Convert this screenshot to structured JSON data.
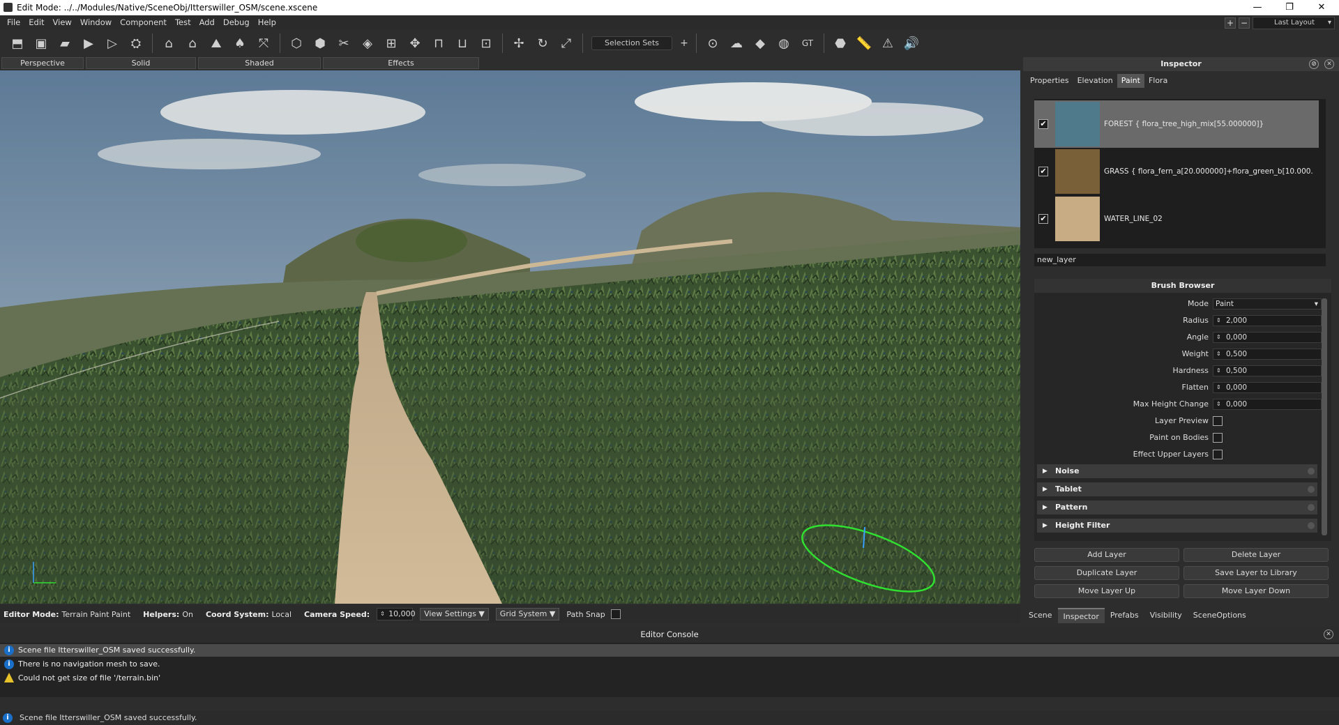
{
  "window": {
    "title": "Edit Mode: ../../Modules/Native/SceneObj/Itterswiller_OSM/scene.xscene",
    "minimize": "—",
    "restore": "❐",
    "close": "✕"
  },
  "menu": [
    "File",
    "Edit",
    "View",
    "Window",
    "Component",
    "Test",
    "Add",
    "Debug",
    "Help"
  ],
  "layout": {
    "add": "+",
    "remove": "−",
    "selected": "Last Layout"
  },
  "toolbar": {
    "selection_sets": "Selection Sets",
    "add": "+",
    "gt_label": "GT"
  },
  "view_tabs": [
    "Perspective",
    "Solid",
    "Shaded",
    "Effects"
  ],
  "statusbar": {
    "editor_mode_label": "Editor Mode:",
    "editor_mode": "Terrain Paint Paint",
    "helpers_label": "Helpers:",
    "helpers": "On",
    "coord_label": "Coord System:",
    "coord": "Local",
    "camera_speed_label": "Camera Speed:",
    "camera_speed": "10,000",
    "view_settings": "View Settings",
    "grid_system": "Grid System",
    "path_snap": "Path Snap"
  },
  "inspector": {
    "title": "Inspector",
    "tabs": [
      "Properties",
      "Elevation",
      "Paint",
      "Flora"
    ],
    "active_tab": "Paint",
    "layers": [
      {
        "name": "FOREST {  flora_tree_high_mix[55.000000]}",
        "checked": true,
        "color": "#4f7a8c"
      },
      {
        "name": "GRASS {  flora_fern_a[20.000000]+flora_green_b[10.000...",
        "checked": true,
        "color": "#7a6038"
      },
      {
        "name": "WATER_LINE_02",
        "checked": true,
        "color": "#c8ad84"
      }
    ],
    "new_layer": "new_layer",
    "brush": {
      "title": "Brush Browser",
      "mode_label": "Mode",
      "mode": "Paint",
      "radius_label": "Radius",
      "radius": "2,000",
      "angle_label": "Angle",
      "angle": "0,000",
      "weight_label": "Weight",
      "weight": "0,500",
      "hardness_label": "Hardness",
      "hardness": "0,500",
      "flatten_label": "Flatten",
      "flatten": "0,000",
      "maxh_label": "Max Height Change",
      "maxh": "0,000",
      "layer_preview": "Layer Preview",
      "paint_bodies": "Paint on Bodies",
      "effect_upper": "Effect Upper Layers",
      "sections": [
        "Noise",
        "Tablet",
        "Pattern",
        "Height Filter"
      ]
    },
    "buttons": {
      "add": "Add Layer",
      "delete": "Delete Layer",
      "duplicate": "Duplicate Layer",
      "save": "Save Layer to Library",
      "up": "Move Layer Up",
      "down": "Move Layer Down"
    }
  },
  "bottom_tabs": [
    "Scene",
    "Inspector",
    "Prefabs",
    "Visibility",
    "SceneOptions"
  ],
  "console": {
    "title": "Editor Console",
    "lines": [
      {
        "type": "info",
        "text": "Scene file Itterswiller_OSM saved successfully."
      },
      {
        "type": "info",
        "text": "There is no navigation mesh to save."
      },
      {
        "type": "warning",
        "text": "Could not get size of file '/terrain.bin'"
      }
    ],
    "footer": "Scene file Itterswiller_OSM saved successfully."
  }
}
